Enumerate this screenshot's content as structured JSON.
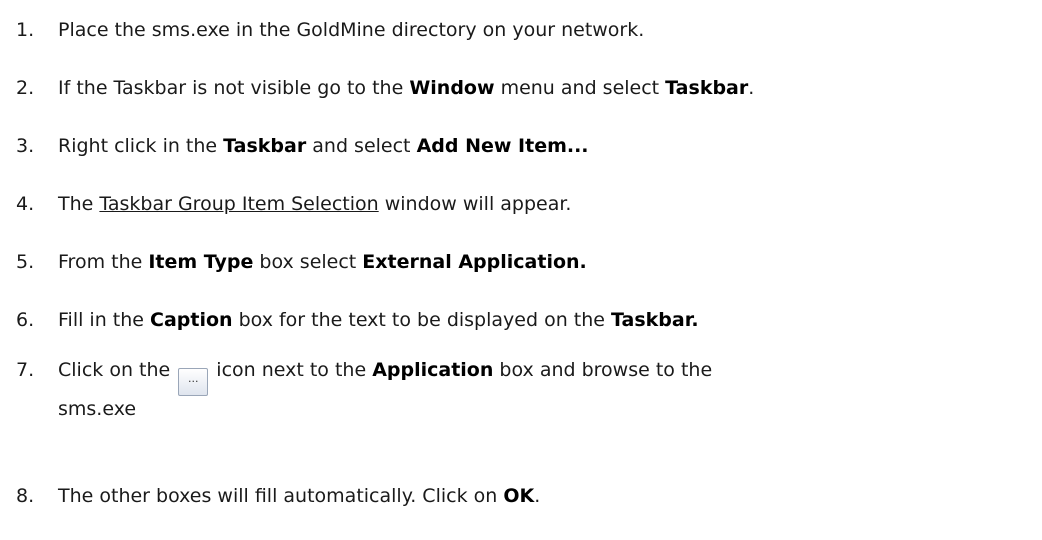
{
  "steps": [
    {
      "number": "1.",
      "text": "Place the sms.exe in the GoldMine directory on your network."
    },
    {
      "number": "2.",
      "t1": "If the Taskbar is not visible go to the ",
      "b1": "Window",
      "t2": " menu and select ",
      "b2": "Taskbar",
      "t3": "."
    },
    {
      "number": "3.",
      "t1": "Right click in the ",
      "b1": "Taskbar",
      "t2": " and select ",
      "b2": "Add New Item..."
    },
    {
      "number": "4.",
      "t1": "The ",
      "link": "Taskbar Group Item Selection",
      "t2": " window will appear."
    },
    {
      "number": "5.",
      "t1": "From the ",
      "b1": "Item Type",
      "t2": " box select ",
      "b2": "External Application."
    },
    {
      "number": "6.",
      "t1": "Fill in the ",
      "b1": "Caption",
      "t2": " box for the text to be displayed on the ",
      "b2": "Taskbar."
    },
    {
      "number": "7.",
      "t1": "Click on the ",
      "button_label": "...",
      "t2": " icon next to the ",
      "b1": "Application",
      "t3": " box and browse to the",
      "t4": "sms.exe"
    },
    {
      "number": "8.",
      "t1": "The other boxes will fill automatically. Click on ",
      "b1": "OK",
      "t2": "."
    }
  ]
}
